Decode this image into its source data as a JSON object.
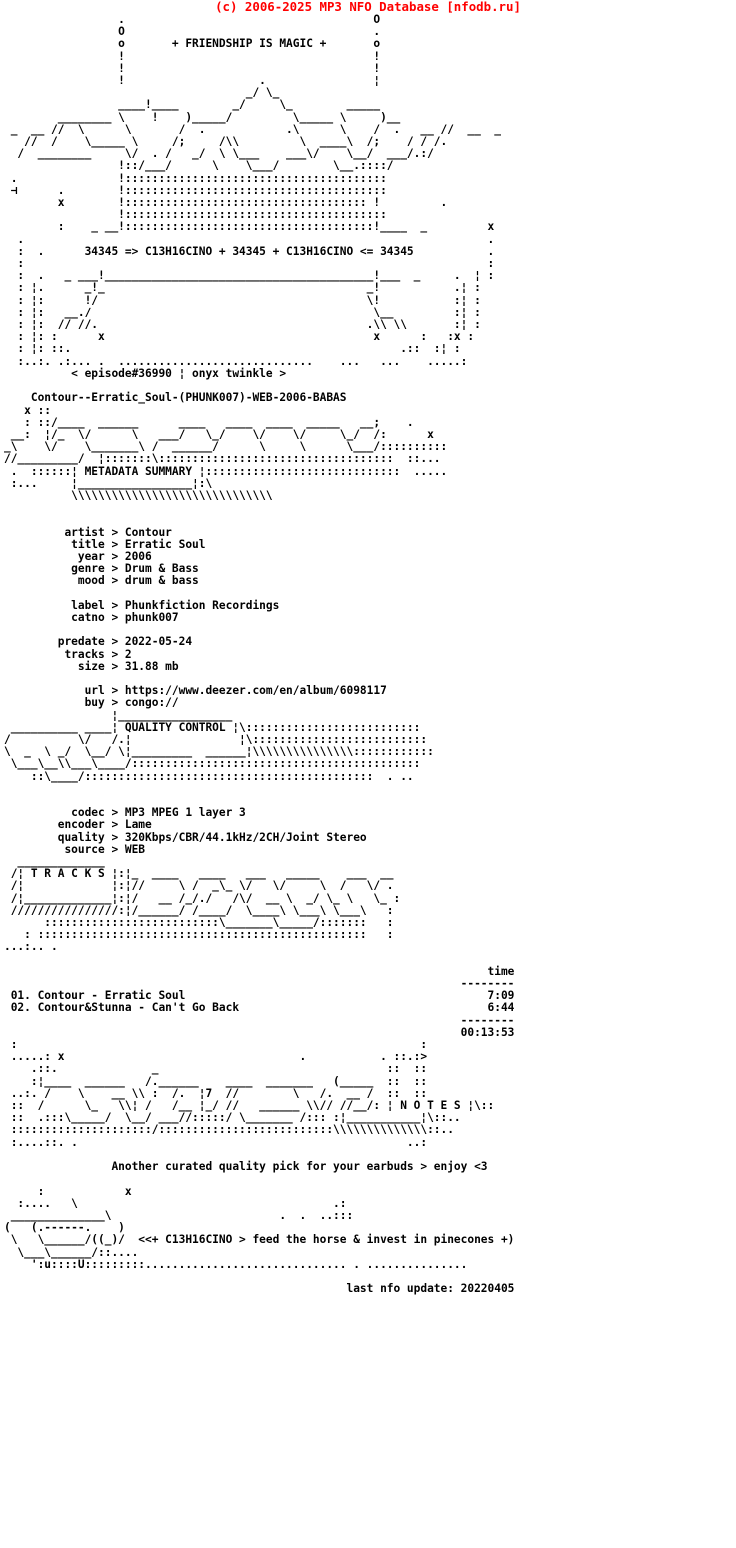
{
  "header": {
    "copyright": "(c) 2006-2025 MP3 NFO Database [nfodb.ru]",
    "color": "#ff0000"
  },
  "banner": {
    "tagline": "+ FRIENDSHIP IS MAGIC +",
    "formula_line": "34345 => C13H16CINO + 34345 + C13H16CINO <= 34345",
    "episode_line": "< episode#36990 ¦ onyx twinkle >",
    "release_name": "Contour--Erratic_Soul-(PHUNK007)-WEB-2006-BABAS",
    "top_art": [
      "                 .                               O",
      "                 O                               .",
      "                 o        + FRIENDSHIP IS MAGIC + o",
      "                 !                               !",
      "                 !                               !",
      "                 !                               ¦",
      "                                    .",
      "                 ______!___      __/ \\__        ______    .",
      "           _____ \\     !   )____//     \\_____  \\      )__/",
      " _  ___ // \\     \\   / .     /       \\   \\   / .   __ //  ___  _",
      "   //  /  \\_____ \\  /;      /  _____  \\ _ \\  /;   / / /.",
      "  /  _________    \\/    .  /  /     \\  \\  \\______/ /::/",
      "                 !::/________/        \\__.:::::::/",
      " .               !::::::::::::::::::::::::::::::::",
      " ⊣      .        !::::::::::::::::::::::::::::::::",
      "        x        !::::::::::::::::::::::::::::: !      .",
      "                 !::::::::::::::::::::::::::::::::",
      "        :    _ ___!:::::::::::::::::::::::::::::!____  _       x"
    ],
    "mid_art": [
      "  .                                                            .",
      "  :  .      34345 => C13H16CINO + 34345 + C13H16CINO <= 34345  :",
      "  :                                                            :",
      "  :  .   _ ___!_____________________________________!___ _   . ¦ :",
      "  : ¦.      _!_                                     _!        ¦ :",
      "  : ¦:      !/                                      \\!       .¦ :",
      "  : ¦:   __.∕                                        \\__     :¦ :",
      "  : ¦:  // //.                                      .\\\\ \\\\    :¦ :",
      "  : ¦: :     x                                        x    : :x :",
      "  : ¦: ::.                                              .:: :¦ :",
      "  :..:. .:... .  .........................   ...  ...    .....:"
    ]
  },
  "metadata_banner": {
    "label": "METADATA SUMMARY",
    "art": [
      "     x ::",
      "     : ::/ __  ___     ___  ___  ___  ___  ____  __;  .",
      "  __ :¦/_ \\/ __\\  /;  __ \\ / \\\\   \\  \\  \\ /   /  ¦     x",
      " _\\     \\/   \\___ \\ /  \\___/  \\___\\  \\_ \\__\\  _/ /:",
      "//______________/  ¦\\_____:::::::::::::::::::::::::/ :",
      " .  ::::::¦ METADATA SUMMARY ¦\\::::::::::::::::::::",
      " :...     ¦_________________¦\\   ...   .   .....",
      "          \\\\\\\\\\\\\\\\\\\\\\\\\\\\\\\\\\"
    ]
  },
  "metadata": {
    "groups": [
      [
        {
          "key": "artist",
          "value": "Contour"
        },
        {
          "key": "title",
          "value": "Erratic Soul"
        },
        {
          "key": "year",
          "value": "2006"
        },
        {
          "key": "genre",
          "value": "Drum & Bass"
        },
        {
          "key": "mood",
          "value": "drum & bass"
        }
      ],
      [
        {
          "key": "label",
          "value": "Phunkfiction Recordings"
        },
        {
          "key": "catno",
          "value": "phunk007"
        }
      ],
      [
        {
          "key": "predate",
          "value": "2022-05-24"
        },
        {
          "key": "tracks",
          "value": "2"
        },
        {
          "key": "size",
          "value": "31.88 mb"
        }
      ],
      [
        {
          "key": "url",
          "value": "https://www.deezer.com/en/album/6098117"
        },
        {
          "key": "buy",
          "value": "congo://"
        }
      ]
    ]
  },
  "quality_banner": {
    "label": "QUALITY CONTROL",
    "art": [
      "                ¦_________________",
      "                ¦ QUALITY CONTROL ¦\\",
      "  _________  ____¦                 ¦\\",
      " /        \\ /   /.¦_________ ______¦\\:::::::::::::  .",
      "/    _   \\/ _/  \\¦          \\\\\\\\\\\\\\\\\\\\\\\\:::::::::::::",
      "\\______  \\\\   \\   \\___________/::::::::::::::::::::::",
      "    ::\\_____/:::::::::::::::::::::::::::::::::::  . ..",
      "                                                   . ..:"
    ]
  },
  "quality": {
    "fields": [
      {
        "key": "codec",
        "value": "MP3 MPEG 1 layer 3"
      },
      {
        "key": "encoder",
        "value": "Lame"
      },
      {
        "key": "quality",
        "value": "320Kbps/CBR/44.1kHz/2CH/Joint Stereo"
      },
      {
        "key": "source",
        "value": "WEB"
      }
    ]
  },
  "tracks_banner": {
    "label": "T R A C K S",
    "art": [
      " _____________",
      "/¦ T R A C K S ¦:¦_  ___  __  ___   _____  __ ____",
      "/¦             ¦:¦// _____  /_\\_  \\/ ___  \\   /   .",
      "/¦_____________¦:¦/  __ /_/./  /  \\/   \\  \\  _/ \\_ :",
      "///////////////:¦/_____/ /___\\   \\___\\ \\___\\ \\__\\:",
      "      :::::::::::::::::::::::\\_____\\____/:::::  :",
      "   : ::::::::::::::::::::::::::::::::::::::::::  :",
      "...:.. ."
    ]
  },
  "tracklist": {
    "time_header": "time",
    "divider": "--------",
    "rows": [
      {
        "num": "01.",
        "title": "Contour - Erratic Soul",
        "time": "7:09"
      },
      {
        "num": "02.",
        "title": "Contour&Stunna - Can't Go Back",
        "time": "6:44"
      }
    ],
    "total": "00:13:53"
  },
  "notes_banner": {
    "label": "N O T E S",
    "art": [
      " :                                                    :",
      " .....: x                                  .   ::  :>",
      "    .::.          _                           ::  ::",
      "    :¦___ \\\\:   __/ _____   ___  _______  (___ ::  ::",
      " ..:. /    _\\  \\¦  /. ¦7  //       \\  /. _ /. _::  ::",
      " ::  /    \\  \\\\¦  /   __ //   ____  \\// //_\\:¦ N O T E S ¦\\::",
      " ::  .:::\\____/::::/ _//__/:::::::::/::::  :¦___________¦\\::..",
      " ::::::::::::::::::::::::::::::::::::::::::::\\\\\\\\\\\\\\\\\\\\\\::..",
      " :....::. .                                           ..:"
    ],
    "text": "Another curated quality pick for your earbuds > enjoy <3"
  },
  "footer": {
    "art": [
      "    :                           x",
      "    :....  \\                                  .:",
      " _____________\\ \\                     .  .  ..:::",
      "(   (.-----.   )",
      " \\   \\_____/((_)/  <<+ C13H16CINO > feed the horse & invest in pinecones +)",
      "  \\___\\_____/::....",
      "    ':u::::U:::::::::..................................  . ................"
    ],
    "tagline": "<<+ C13H16CINO > feed the horse & invest in pinecones +)",
    "last_update": "last nfo update: 20220405"
  }
}
